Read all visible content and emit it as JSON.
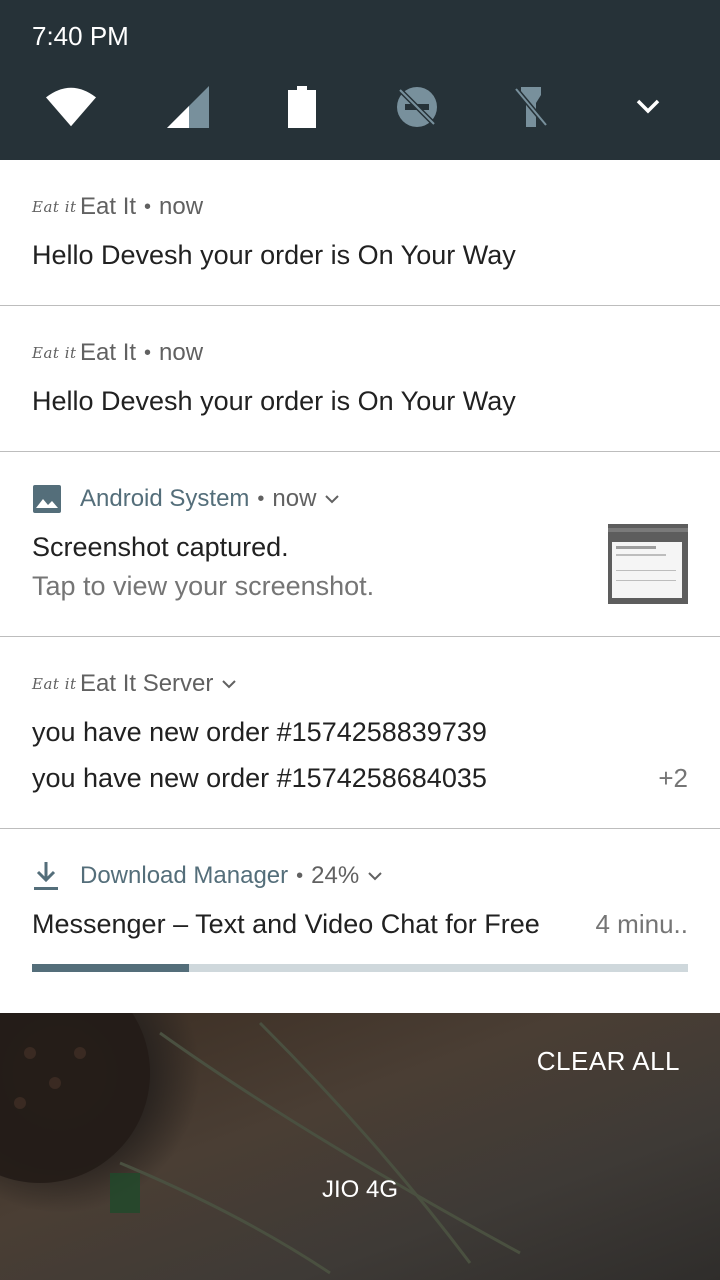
{
  "status_bar": {
    "time": "7:40 PM",
    "tiles": [
      {
        "icon": "wifi-icon"
      },
      {
        "icon": "cellular-signal-icon"
      },
      {
        "icon": "battery-icon"
      },
      {
        "icon": "do-not-disturb-off-icon"
      },
      {
        "icon": "flashlight-off-icon"
      },
      {
        "icon": "expand-chevron-icon"
      }
    ]
  },
  "notifications": [
    {
      "logo": "Eat it",
      "app": "Eat It",
      "time": "now",
      "text": "Hello Devesh your order is On Your Way"
    },
    {
      "logo": "Eat it",
      "app": "Eat It",
      "time": "now",
      "text": "Hello Devesh your order is On Your Way"
    },
    {
      "app": "Android System",
      "time": "now",
      "title": "Screenshot captured.",
      "text": "Tap to view your screenshot."
    },
    {
      "logo": "Eat it",
      "app": "Eat It Server",
      "lines": [
        "you have new order #1574258839739",
        "you have new order #1574258684035"
      ],
      "more": "+2"
    },
    {
      "app": "Download Manager",
      "progress_text": "24%",
      "progress": 0.24,
      "title": "Messenger – Text and Video Chat for Free",
      "eta": "4 minu.."
    }
  ],
  "clear_all": "CLEAR ALL",
  "carrier": "JIO 4G",
  "colors": {
    "header_bg": "#263238",
    "accent": "#546e7a",
    "progress_track": "#cfd8dc"
  }
}
